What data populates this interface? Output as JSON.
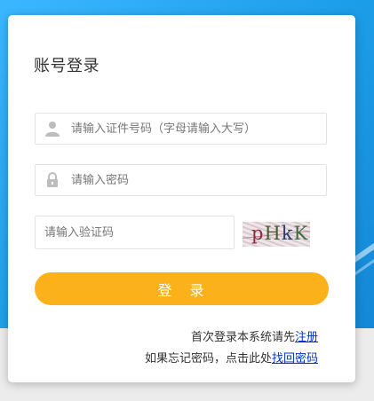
{
  "form": {
    "title": "账号登录",
    "username_placeholder": "请输入证件号码（字母请输入大写）",
    "password_placeholder": "请输入密码",
    "captcha_placeholder": "请输入验证码",
    "captcha_chars": [
      "p",
      "H",
      "k",
      "K"
    ],
    "login_label": "登　录"
  },
  "links": {
    "register_prefix": "首次登录本系统请先",
    "register_link": "注册",
    "forgot_prefix": "如果忘记密码，点击此处",
    "forgot_link": "找回密码"
  },
  "icons": {
    "user": "user-icon",
    "password": "lock-icon"
  },
  "colors": {
    "accent": "#fbb11a",
    "link": "#0033cc",
    "background": "#1d9ee8"
  }
}
